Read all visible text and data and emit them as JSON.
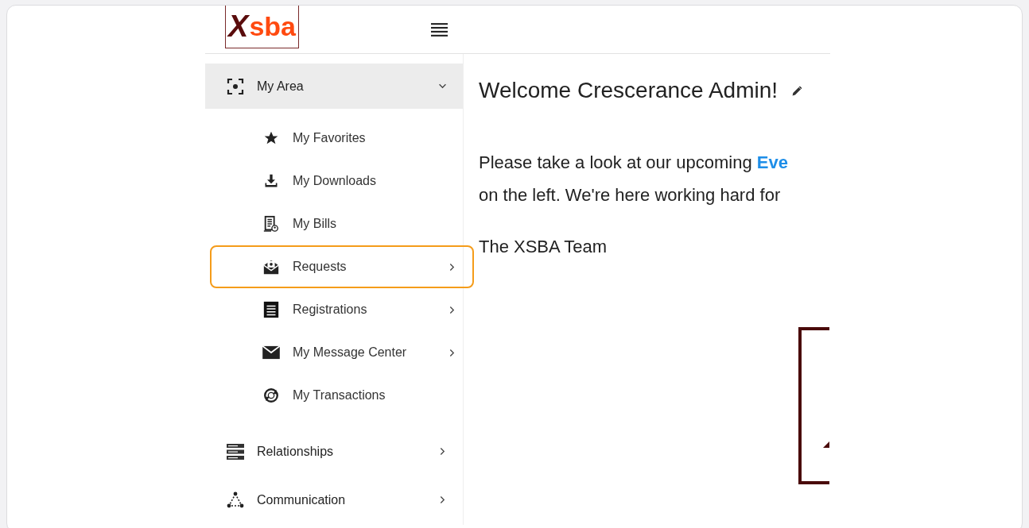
{
  "header": {
    "logo": {
      "mark": "X",
      "text": "sba"
    }
  },
  "sidebar": {
    "items": [
      {
        "label": "My Area",
        "expanded": true,
        "submenu": true,
        "highlighted": false,
        "children": [
          {
            "label": "My Favorites",
            "submenu": false,
            "highlighted": false
          },
          {
            "label": "My Downloads",
            "submenu": false,
            "highlighted": false
          },
          {
            "label": "My Bills",
            "submenu": false,
            "highlighted": false
          },
          {
            "label": "Requests",
            "submenu": true,
            "highlighted": true
          },
          {
            "label": "Registrations",
            "submenu": true,
            "highlighted": false
          },
          {
            "label": "My Message Center",
            "submenu": true,
            "highlighted": false
          },
          {
            "label": "My Transactions",
            "submenu": false,
            "highlighted": false
          }
        ]
      },
      {
        "label": "Relationships",
        "expanded": false,
        "submenu": true,
        "highlighted": false
      },
      {
        "label": "Communication",
        "expanded": false,
        "submenu": true,
        "highlighted": false
      }
    ]
  },
  "main": {
    "title": "Welcome Crescerance Admin!",
    "lines": [
      {
        "text": "Please take a look at our upcoming ",
        "link": "Eve"
      },
      {
        "text": "on the left.  We're here working hard for"
      }
    ],
    "signature": "The XSBA Team"
  }
}
